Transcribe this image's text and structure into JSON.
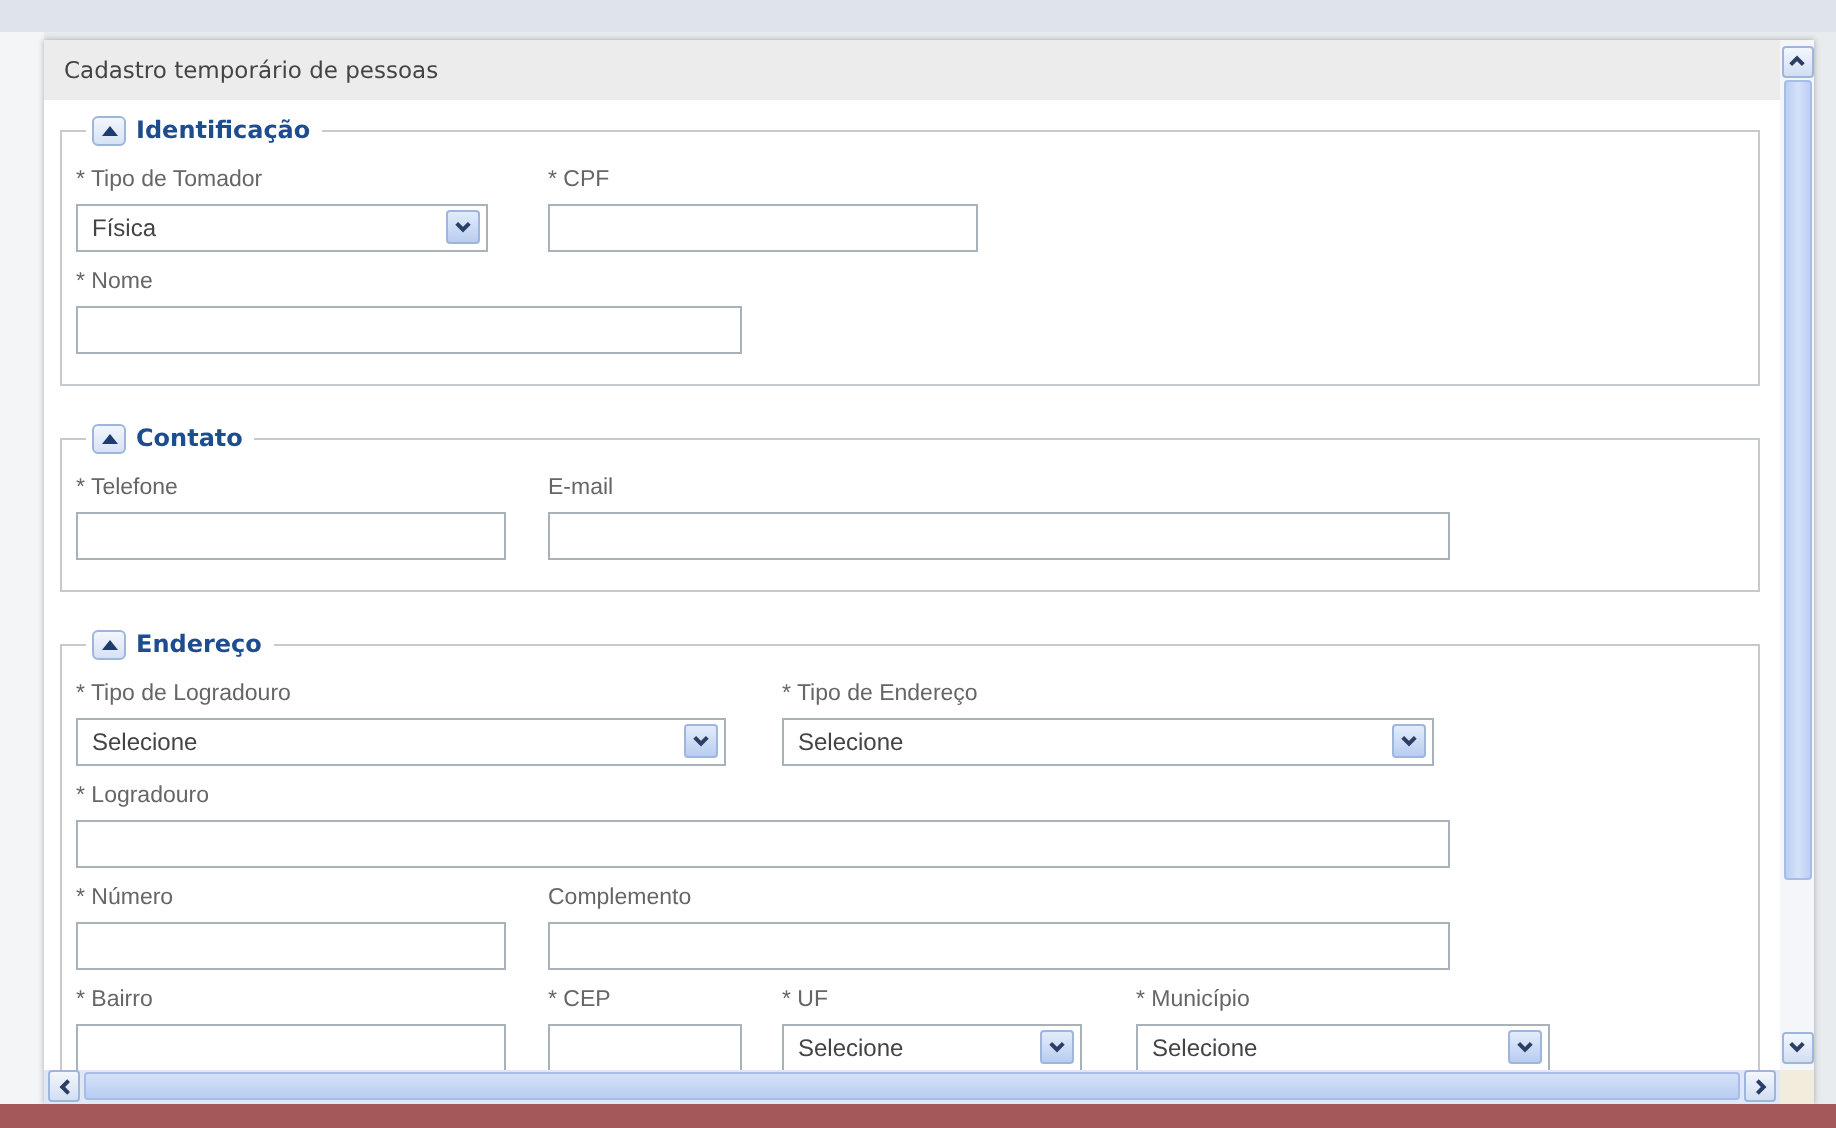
{
  "dialog": {
    "title": "Cadastro temporário de pessoas"
  },
  "sections": [
    {
      "title": "Identificação",
      "expanded": true,
      "lines": [
        {
          "fields": [
            {
              "label": "* Tipo de Tomador",
              "kind": "select",
              "value": "Física"
            },
            {
              "label": "* CPF",
              "kind": "text"
            }
          ]
        },
        {
          "fields": [
            {
              "label": "* Nome",
              "kind": "text"
            }
          ]
        }
      ]
    },
    {
      "title": "Contato",
      "expanded": true,
      "lines": [
        {
          "fields": [
            {
              "label": "* Telefone",
              "kind": "text"
            },
            {
              "label": "E-mail",
              "kind": "text"
            }
          ]
        }
      ]
    },
    {
      "title": "Endereço",
      "expanded": true,
      "lines": [
        {
          "fields": [
            {
              "label": "* Tipo de Logradouro",
              "kind": "select",
              "value": "Selecione"
            },
            {
              "label": "* Tipo de Endereço",
              "kind": "select",
              "value": "Selecione"
            }
          ]
        },
        {
          "fields": [
            {
              "label": "* Logradouro",
              "kind": "text"
            }
          ]
        },
        {
          "fields": [
            {
              "label": "* Número",
              "kind": "text"
            },
            {
              "label": "Complemento",
              "kind": "text"
            }
          ]
        },
        {
          "fields": [
            {
              "label": "* Bairro",
              "kind": "text"
            },
            {
              "label": "* CEP",
              "kind": "text"
            },
            {
              "label": "* UF",
              "kind": "select",
              "value": "Selecione"
            },
            {
              "label": "* Município",
              "kind": "select",
              "value": "Selecione"
            }
          ]
        }
      ]
    }
  ]
}
